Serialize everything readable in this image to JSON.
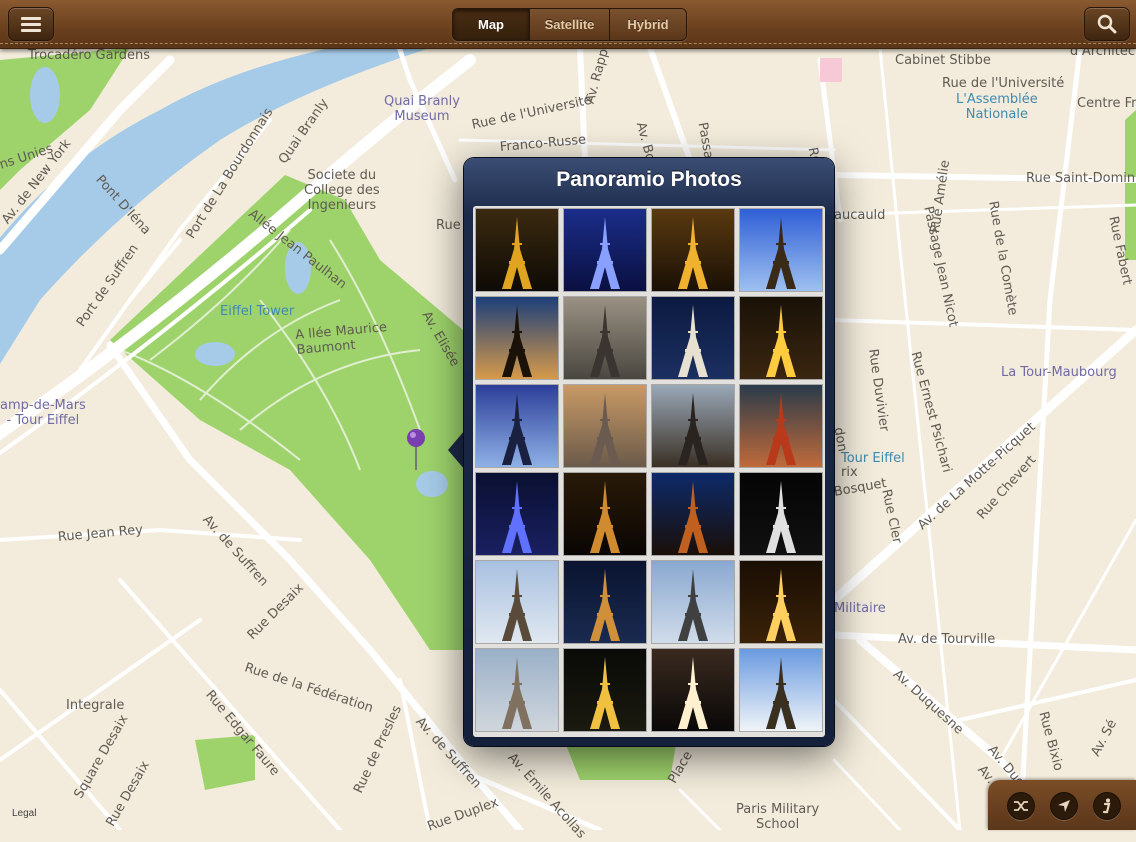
{
  "topbar": {
    "menu_icon": "hamburger-icon",
    "search_icon": "magnifier-icon",
    "map_types": [
      "Map",
      "Satellite",
      "Hybrid"
    ],
    "active_map_type": "Map"
  },
  "popover": {
    "title": "Panoramio Photos",
    "photo_count": 24
  },
  "map": {
    "labels": {
      "trocadero": "Trocadéro Gardens",
      "unies": "ns Unies",
      "av_ny": "New York",
      "av_de_ny": "Av. de New York",
      "pont_diena": "Pont D'Iéna",
      "port_bourdonnais": "Port de La Bourdonnais",
      "quai_branly": "Quai Branly",
      "quai_branly_museum": "Quai Branly\nMuseum",
      "rue_universite_1": "Rue de l'Université",
      "av_rapp": "Av. Rapp",
      "av_bosquet": "Av. Bosquet",
      "passage": "Passag",
      "rue_malar": "Rue Malar",
      "cabinet_stibbe": "Cabinet Stibbe",
      "rue_universite_2": "Rue de l'Université",
      "assemblee": "L'Assemblée\nNationale",
      "centre_fr": "Centre Fr",
      "dachstre": "d'Architec",
      "societe": "Societe du\nCollege des\nIngenieurs",
      "allee_paulhan": "Allée Jean Paulhan",
      "franco_russe": "Franco-Russe",
      "port_suffren": "Port de Suffren",
      "eiffel_tower": "Eiffel Tower",
      "allee_monmont": "A llée Maurice\nBaumont",
      "av_elisee": "Av. Elisée",
      "rue_short": "Rue",
      "rue_st_dominique": "Rue Saint-Domin",
      "passage_nicot": "Passage Jean Nicot",
      "rue_amelie": "Rue Amélie",
      "rue_comete": "Rue de la Comète",
      "rue_fabert": "Rue Fabert",
      "aucauld": "aucauld",
      "champ_mars": "amp-de-Mars\n- Tour Eiffel",
      "rue_duvivier": "Rue Duvivier",
      "rue_psichari": "Rue Ernest Psichari",
      "la_tour_maubourg": "La Tour-Maubourg",
      "tour_eiffel_r": "Tour Eiffel",
      "rix": "rix",
      "bosquet_r": "Bosquet",
      "rue_cler": "Rue Cler",
      "av_motte": "Av. de La Motte-Picquet",
      "rue_chevert": "Rue Chevert",
      "don": "don",
      "rue_jean_rey": "Rue Jean Rey",
      "av_suffren_1": "Av. de Suffren",
      "rue_desaix": "Rue Desaix",
      "militaire": "Militaire",
      "av_tourville": "Av. de Tourville",
      "rue_federation": "Rue de la Fédération",
      "integrale": "Integrale",
      "rue_edgar": "Rue Edgar Faure",
      "square_desaix": "Square Desaix",
      "rue_desaix_2": "Rue Desaix",
      "rue_presles": "Rue de Presles",
      "av_suffren_2": "Av. de Suffren",
      "av_emile": "Av. Émile Acollas",
      "rue_duplex": "Rue Duplex",
      "place": "Place",
      "av_duquesne": "Av. Duquesne",
      "av_duquesne_2": "Av. Duquesne",
      "rue_bixio": "Rue Bixio",
      "av_se": "Av. Sé",
      "paris_military": "Paris Military\nSchool",
      "rue_d": "Av. D",
      "legal": "Legal"
    }
  },
  "bottom": {
    "icons": [
      "shuffle-icon",
      "location-arrow-icon",
      "info-icon"
    ]
  },
  "colors": {
    "map_bg": "#f3ecdc",
    "park": "#9ed36c",
    "water": "#a6cbe8",
    "road": "#ffffff",
    "leather": "#6c421f",
    "popover": "#1c2a49",
    "pin": "#7a3fb0"
  }
}
